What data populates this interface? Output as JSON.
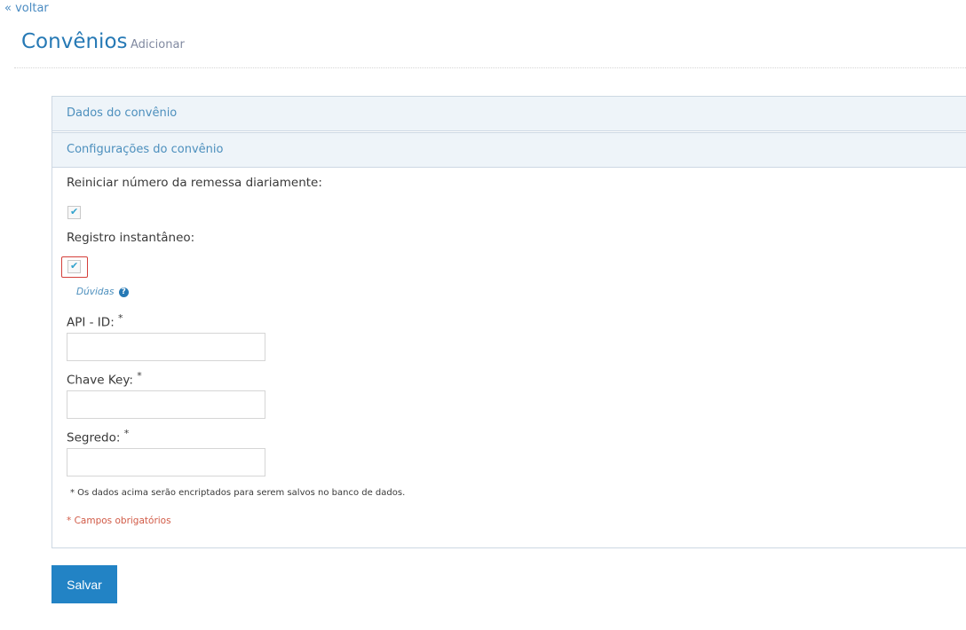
{
  "nav": {
    "back_label": "« voltar"
  },
  "header": {
    "title": "Convênios",
    "subtitle": "Adicionar"
  },
  "sections": [
    {
      "label": "Dados do convênio"
    },
    {
      "label": "Configurações do convênio"
    }
  ],
  "form": {
    "reset_daily_label": "Reiniciar número da remessa diariamente:",
    "reset_daily_checked": true,
    "instant_registration_label": "Registro instantâneo:",
    "instant_registration_checked": true,
    "help_link": "Dúvidas",
    "help_icon": "?",
    "api_id_label": "API - ID:",
    "api_id_value": "",
    "chave_key_label": "Chave Key:",
    "chave_key_value": "",
    "segredo_label": "Segredo:",
    "segredo_value": "",
    "required_marker": "*",
    "encryption_note": "* Os dados acima serão encriptados para serem salvos no banco de dados.",
    "required_note": "* Campos obrigatórios"
  },
  "actions": {
    "save_label": "Salvar"
  },
  "colors": {
    "accent": "#2283c5",
    "section_bg": "#eef4f9",
    "required": "#d15b47"
  }
}
